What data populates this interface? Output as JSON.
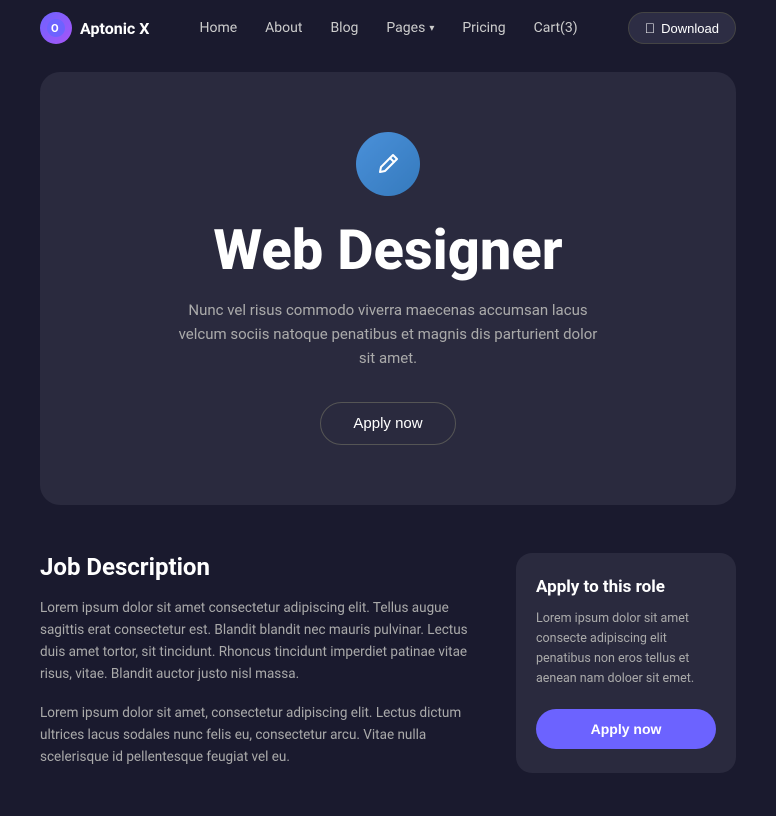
{
  "nav": {
    "logo_text": "Aptonic X",
    "links": [
      {
        "label": "Home",
        "has_dropdown": false
      },
      {
        "label": "About",
        "has_dropdown": false
      },
      {
        "label": "Blog",
        "has_dropdown": false
      },
      {
        "label": "Pages",
        "has_dropdown": true
      },
      {
        "label": "Pricing",
        "has_dropdown": false
      },
      {
        "label": "Cart(3)",
        "has_dropdown": false
      }
    ],
    "download_btn": "Download"
  },
  "hero": {
    "icon": "✏️",
    "title": "Web Designer",
    "description": "Nunc vel risus commodo viverra maecenas accumsan lacus velcum sociis natoque penatibus et magnis dis parturient dolor sit amet.",
    "apply_btn": "Apply now"
  },
  "job_description": {
    "title": "Job Description",
    "paragraph1": "Lorem ipsum dolor sit amet consectetur adipiscing elit. Tellus augue sagittis erat consectetur est. Blandit blandit nec mauris pulvinar. Lectus duis amet tortor, sit tincidunt. Rhoncus tincidunt imperdiet patinae vitae risus, vitae. Blandit auctor justo nisl massa.",
    "paragraph2": "Lorem ipsum dolor sit amet, consectetur adipiscing elit. Lectus dictum ultrices lacus sodales nunc felis eu, consectetur arcu. Vitae nulla scelerisque id pellentesque feugiat vel eu."
  },
  "apply_card": {
    "title": "Apply to this role",
    "description": "Lorem ipsum dolor sit amet consecte adipiscing elit penatibus non eros tellus et aenean nam doloer sit emet.",
    "apply_btn": "Apply now"
  }
}
